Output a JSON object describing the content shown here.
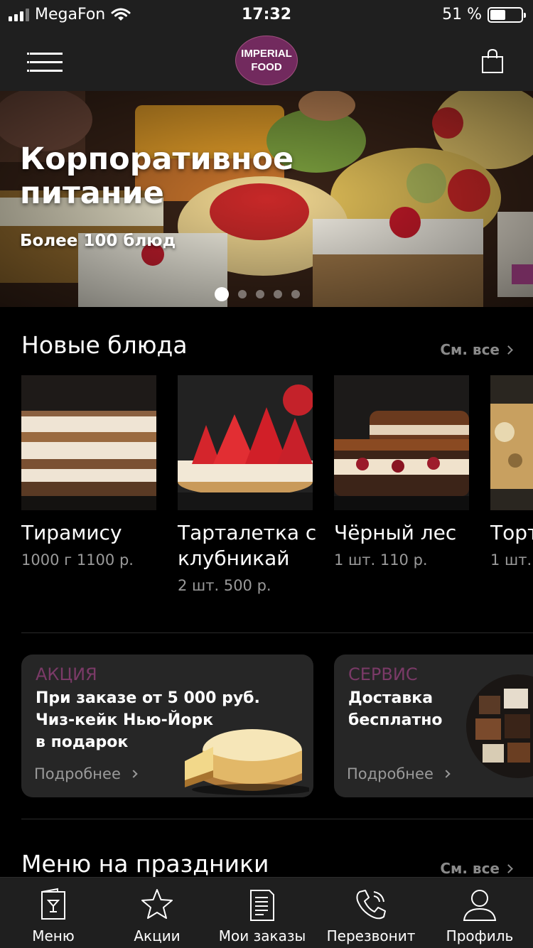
{
  "status_bar": {
    "carrier": "MegaFon",
    "time": "17:32",
    "battery_percent": "51 %",
    "battery_level": 0.51
  },
  "nav": {
    "logo_line1": "IMPERIAL",
    "logo_line2": "FOOD",
    "logo_color": "#722a5e"
  },
  "hero": {
    "title": "Корпоративное питание",
    "subtitle": "Более 100 блюд",
    "active_slide": 1,
    "slide_count": 5
  },
  "new_dishes": {
    "title": "Новые блюда",
    "see_all": "См. все",
    "items": [
      {
        "name": "Тирамису",
        "meta": "1000 г  1100 р."
      },
      {
        "name": "Тарталетка с клубникай",
        "name_line1": "Тарталетка с",
        "name_line2": "клубникай",
        "meta": "2 шт. 500 р."
      },
      {
        "name": "Чёрный лес",
        "meta": "1 шт.  110 р."
      },
      {
        "name": "Торт",
        "meta": "1 шт."
      }
    ]
  },
  "promos": [
    {
      "tag": "АКЦИЯ",
      "line1": "При заказе от 5 000 руб.",
      "line2": "Чиз-кейк Нью-Йорк",
      "line3": "в подарок",
      "more": "Подробнее"
    },
    {
      "tag": "СЕРВИС",
      "line1": "Доставка",
      "line2": "бесплатно",
      "more": "Подробнее"
    }
  ],
  "holiday_menu": {
    "title": "Меню на праздники",
    "see_all": "См. все"
  },
  "tab_bar": {
    "items": [
      {
        "label": "Меню",
        "icon": "menu-card-icon"
      },
      {
        "label": "Акции",
        "icon": "star-icon"
      },
      {
        "label": "Мои заказы",
        "icon": "document-icon"
      },
      {
        "label": "Перезвонит",
        "icon": "phone-icon"
      },
      {
        "label": "Профиль",
        "icon": "profile-icon"
      }
    ]
  },
  "colors": {
    "accent": "#722a5e",
    "tag": "#7a3a67",
    "background": "#000000",
    "panel": "#1f1f1f",
    "card": "#262626"
  }
}
